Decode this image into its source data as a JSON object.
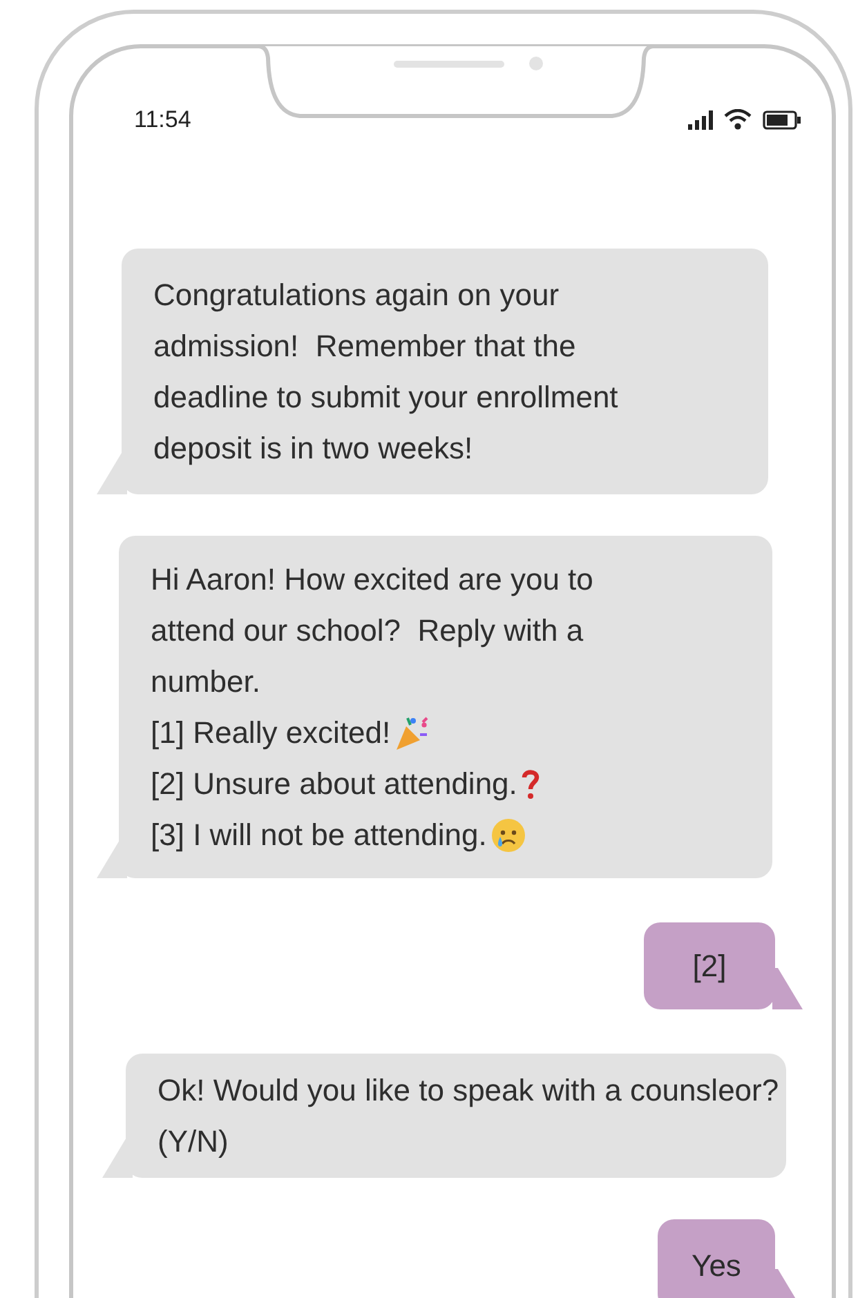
{
  "status_bar": {
    "time": "11:54"
  },
  "messages": [
    {
      "kind": "received",
      "text": "Congratulations again on your admission!  Remember that the deadline to submit your enrollment deposit is in two weeks!"
    },
    {
      "kind": "received",
      "text": "Hi Aaron! How excited are you to attend our school?  Reply with a number.",
      "options": [
        {
          "text": "[1] Really excited!",
          "kind": "party"
        },
        {
          "text": "[2] Unsure about attending.",
          "kind": "question"
        },
        {
          "text": "[3] I will not be attending.",
          "kind": "crying"
        }
      ]
    },
    {
      "kind": "sent",
      "text": "[2]"
    },
    {
      "kind": "received",
      "text": "Ok! Would you like to speak with a counsleor? (Y/N)"
    },
    {
      "kind": "sent",
      "text": "Yes"
    }
  ]
}
